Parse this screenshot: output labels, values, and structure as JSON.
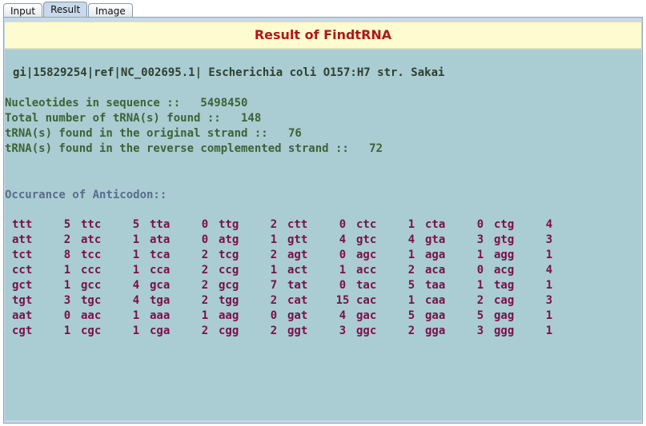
{
  "tabs": [
    {
      "label": "Input",
      "active": false
    },
    {
      "label": "Result",
      "active": true
    },
    {
      "label": "Image",
      "active": false
    }
  ],
  "result": {
    "title": "Result of FindtRNA",
    "sequence_name": "gi|15829254|ref|NC_002695.1| Escherichia coli O157:H7 str. Sakai",
    "stats": [
      "Nucleotides in sequence ::   5498450",
      "Total number of tRNA(s) found ::   148",
      "tRNA(s) found in the original strand ::   76",
      "tRNA(s) found in the reverse complemented strand ::   72"
    ],
    "anticodon_heading": "Occurance of Anticodon::",
    "anticodon_rows": [
      [
        [
          "ttt",
          "5"
        ],
        [
          "ttc",
          "5"
        ],
        [
          "tta",
          "0"
        ],
        [
          "ttg",
          "2"
        ],
        [
          "ctt",
          "0"
        ],
        [
          "ctc",
          "1"
        ],
        [
          "cta",
          "0"
        ],
        [
          "ctg",
          "4"
        ]
      ],
      [
        [
          "att",
          "2"
        ],
        [
          "atc",
          "1"
        ],
        [
          "ata",
          "0"
        ],
        [
          "atg",
          "1"
        ],
        [
          "gtt",
          "4"
        ],
        [
          "gtc",
          "4"
        ],
        [
          "gta",
          "3"
        ],
        [
          "gtg",
          "3"
        ]
      ],
      [
        [
          "tct",
          "8"
        ],
        [
          "tcc",
          "1"
        ],
        [
          "tca",
          "2"
        ],
        [
          "tcg",
          "2"
        ],
        [
          "agt",
          "0"
        ],
        [
          "agc",
          "1"
        ],
        [
          "aga",
          "1"
        ],
        [
          "agg",
          "1"
        ]
      ],
      [
        [
          "cct",
          "1"
        ],
        [
          "ccc",
          "1"
        ],
        [
          "cca",
          "2"
        ],
        [
          "ccg",
          "1"
        ],
        [
          "act",
          "1"
        ],
        [
          "acc",
          "2"
        ],
        [
          "aca",
          "0"
        ],
        [
          "acg",
          "4"
        ]
      ],
      [
        [
          "gct",
          "1"
        ],
        [
          "gcc",
          "4"
        ],
        [
          "gca",
          "2"
        ],
        [
          "gcg",
          "7"
        ],
        [
          "tat",
          "0"
        ],
        [
          "tac",
          "5"
        ],
        [
          "taa",
          "1"
        ],
        [
          "tag",
          "1"
        ]
      ],
      [
        [
          "tgt",
          "3"
        ],
        [
          "tgc",
          "4"
        ],
        [
          "tga",
          "2"
        ],
        [
          "tgg",
          "2"
        ],
        [
          "cat",
          "15"
        ],
        [
          "cac",
          "1"
        ],
        [
          "caa",
          "2"
        ],
        [
          "cag",
          "3"
        ]
      ],
      [
        [
          "aat",
          "0"
        ],
        [
          "aac",
          "1"
        ],
        [
          "aaa",
          "1"
        ],
        [
          "aag",
          "0"
        ],
        [
          "gat",
          "4"
        ],
        [
          "gac",
          "5"
        ],
        [
          "gaa",
          "5"
        ],
        [
          "gag",
          "1"
        ]
      ],
      [
        [
          "cgt",
          "1"
        ],
        [
          "cgc",
          "1"
        ],
        [
          "cga",
          "2"
        ],
        [
          "cgg",
          "2"
        ],
        [
          "ggt",
          "3"
        ],
        [
          "ggc",
          "2"
        ],
        [
          "gga",
          "3"
        ],
        [
          "ggg",
          "1"
        ]
      ]
    ]
  },
  "colors": {
    "title": "#b01818",
    "title_bg": "#fffbd0",
    "content_bg": "#a9cdd2",
    "stats_text": "#3c6436",
    "heading_text": "#5a6c8c",
    "codon_text": "#7a1048",
    "active_tab": "#c7d9ea"
  }
}
